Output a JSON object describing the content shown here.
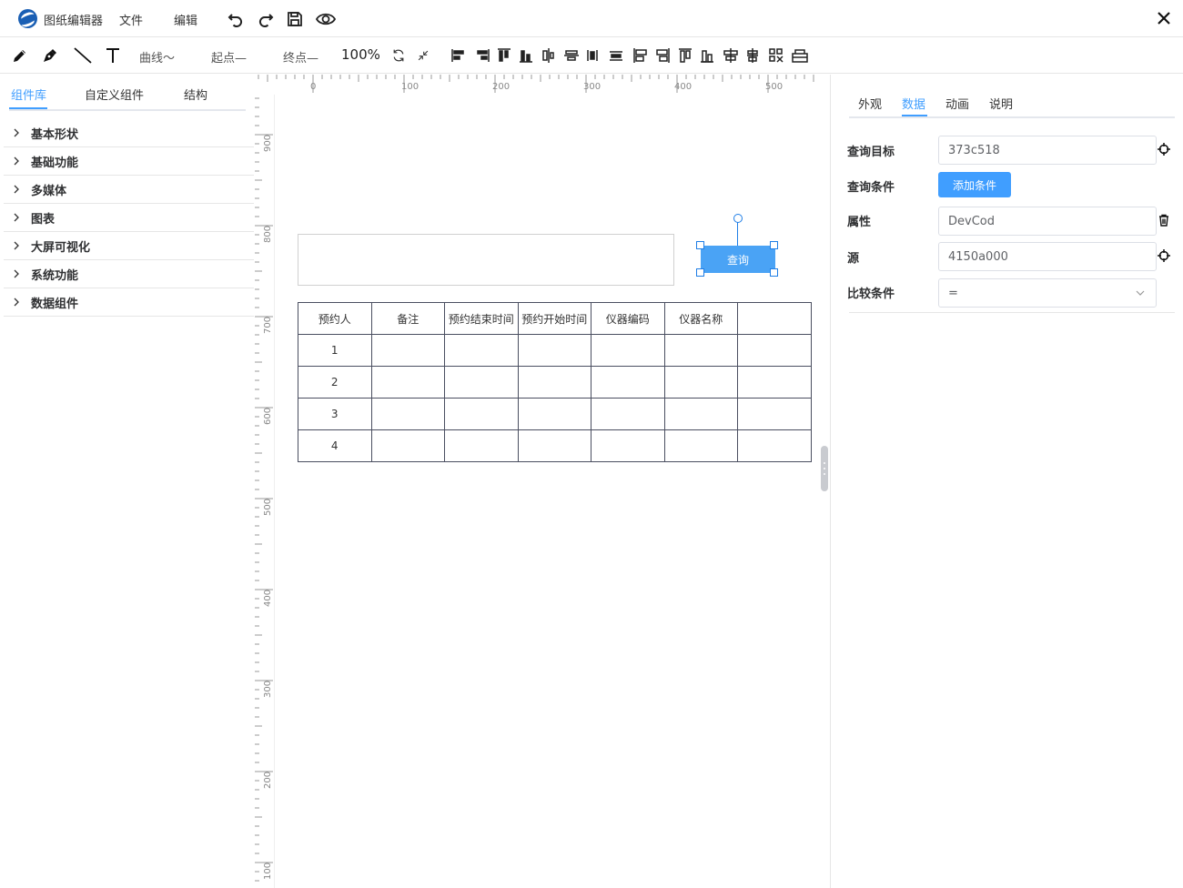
{
  "app": {
    "title": "图纸编辑器",
    "menu": {
      "file": "文件",
      "edit": "编辑"
    },
    "icons": [
      "undo-icon",
      "redo-icon",
      "save-icon",
      "preview-eye-icon",
      "close-icon"
    ]
  },
  "toolbar": {
    "curve": "曲线～",
    "start": "起点—",
    "end": "终点—",
    "zoom": "100%"
  },
  "left_panel": {
    "tabs": [
      "组件库",
      "自定义组件",
      "结构"
    ],
    "active_tab": "组件库",
    "categories": [
      "基本形状",
      "基础功能",
      "多媒体",
      "图表",
      "大屏可视化",
      "系统功能",
      "数据组件"
    ]
  },
  "rulers": {
    "top": [
      "0",
      "100",
      "200",
      "300",
      "400",
      "500"
    ],
    "left": [
      "900",
      "800",
      "700",
      "600",
      "500",
      "400",
      "300",
      "200",
      "100"
    ]
  },
  "canvas": {
    "query_button": "查询",
    "table": {
      "headers": [
        "预约人",
        "备注",
        "预约结束时间",
        "预约开始时间",
        "仪器编码",
        "仪器名称",
        ""
      ],
      "rows": [
        [
          "1",
          "",
          "",
          "",
          "",
          "",
          ""
        ],
        [
          "2",
          "",
          "",
          "",
          "",
          "",
          ""
        ],
        [
          "3",
          "",
          "",
          "",
          "",
          "",
          ""
        ],
        [
          "4",
          "",
          "",
          "",
          "",
          "",
          ""
        ]
      ]
    }
  },
  "right_panel": {
    "tabs": [
      "外观",
      "数据",
      "动画",
      "说明"
    ],
    "active_tab": "数据",
    "fields": {
      "query_target": {
        "label": "查询目标",
        "value": "373c518"
      },
      "query_condition": {
        "label": "查询条件",
        "button": "添加条件"
      },
      "attribute": {
        "label": "属性",
        "value": "DevCod"
      },
      "source": {
        "label": "源",
        "value": "4150a000"
      },
      "compare": {
        "label": "比较条件",
        "value": "="
      }
    }
  },
  "colors": {
    "accent": "#409eff",
    "button": "#4aa3f5",
    "selection": "#1f7ee6"
  }
}
